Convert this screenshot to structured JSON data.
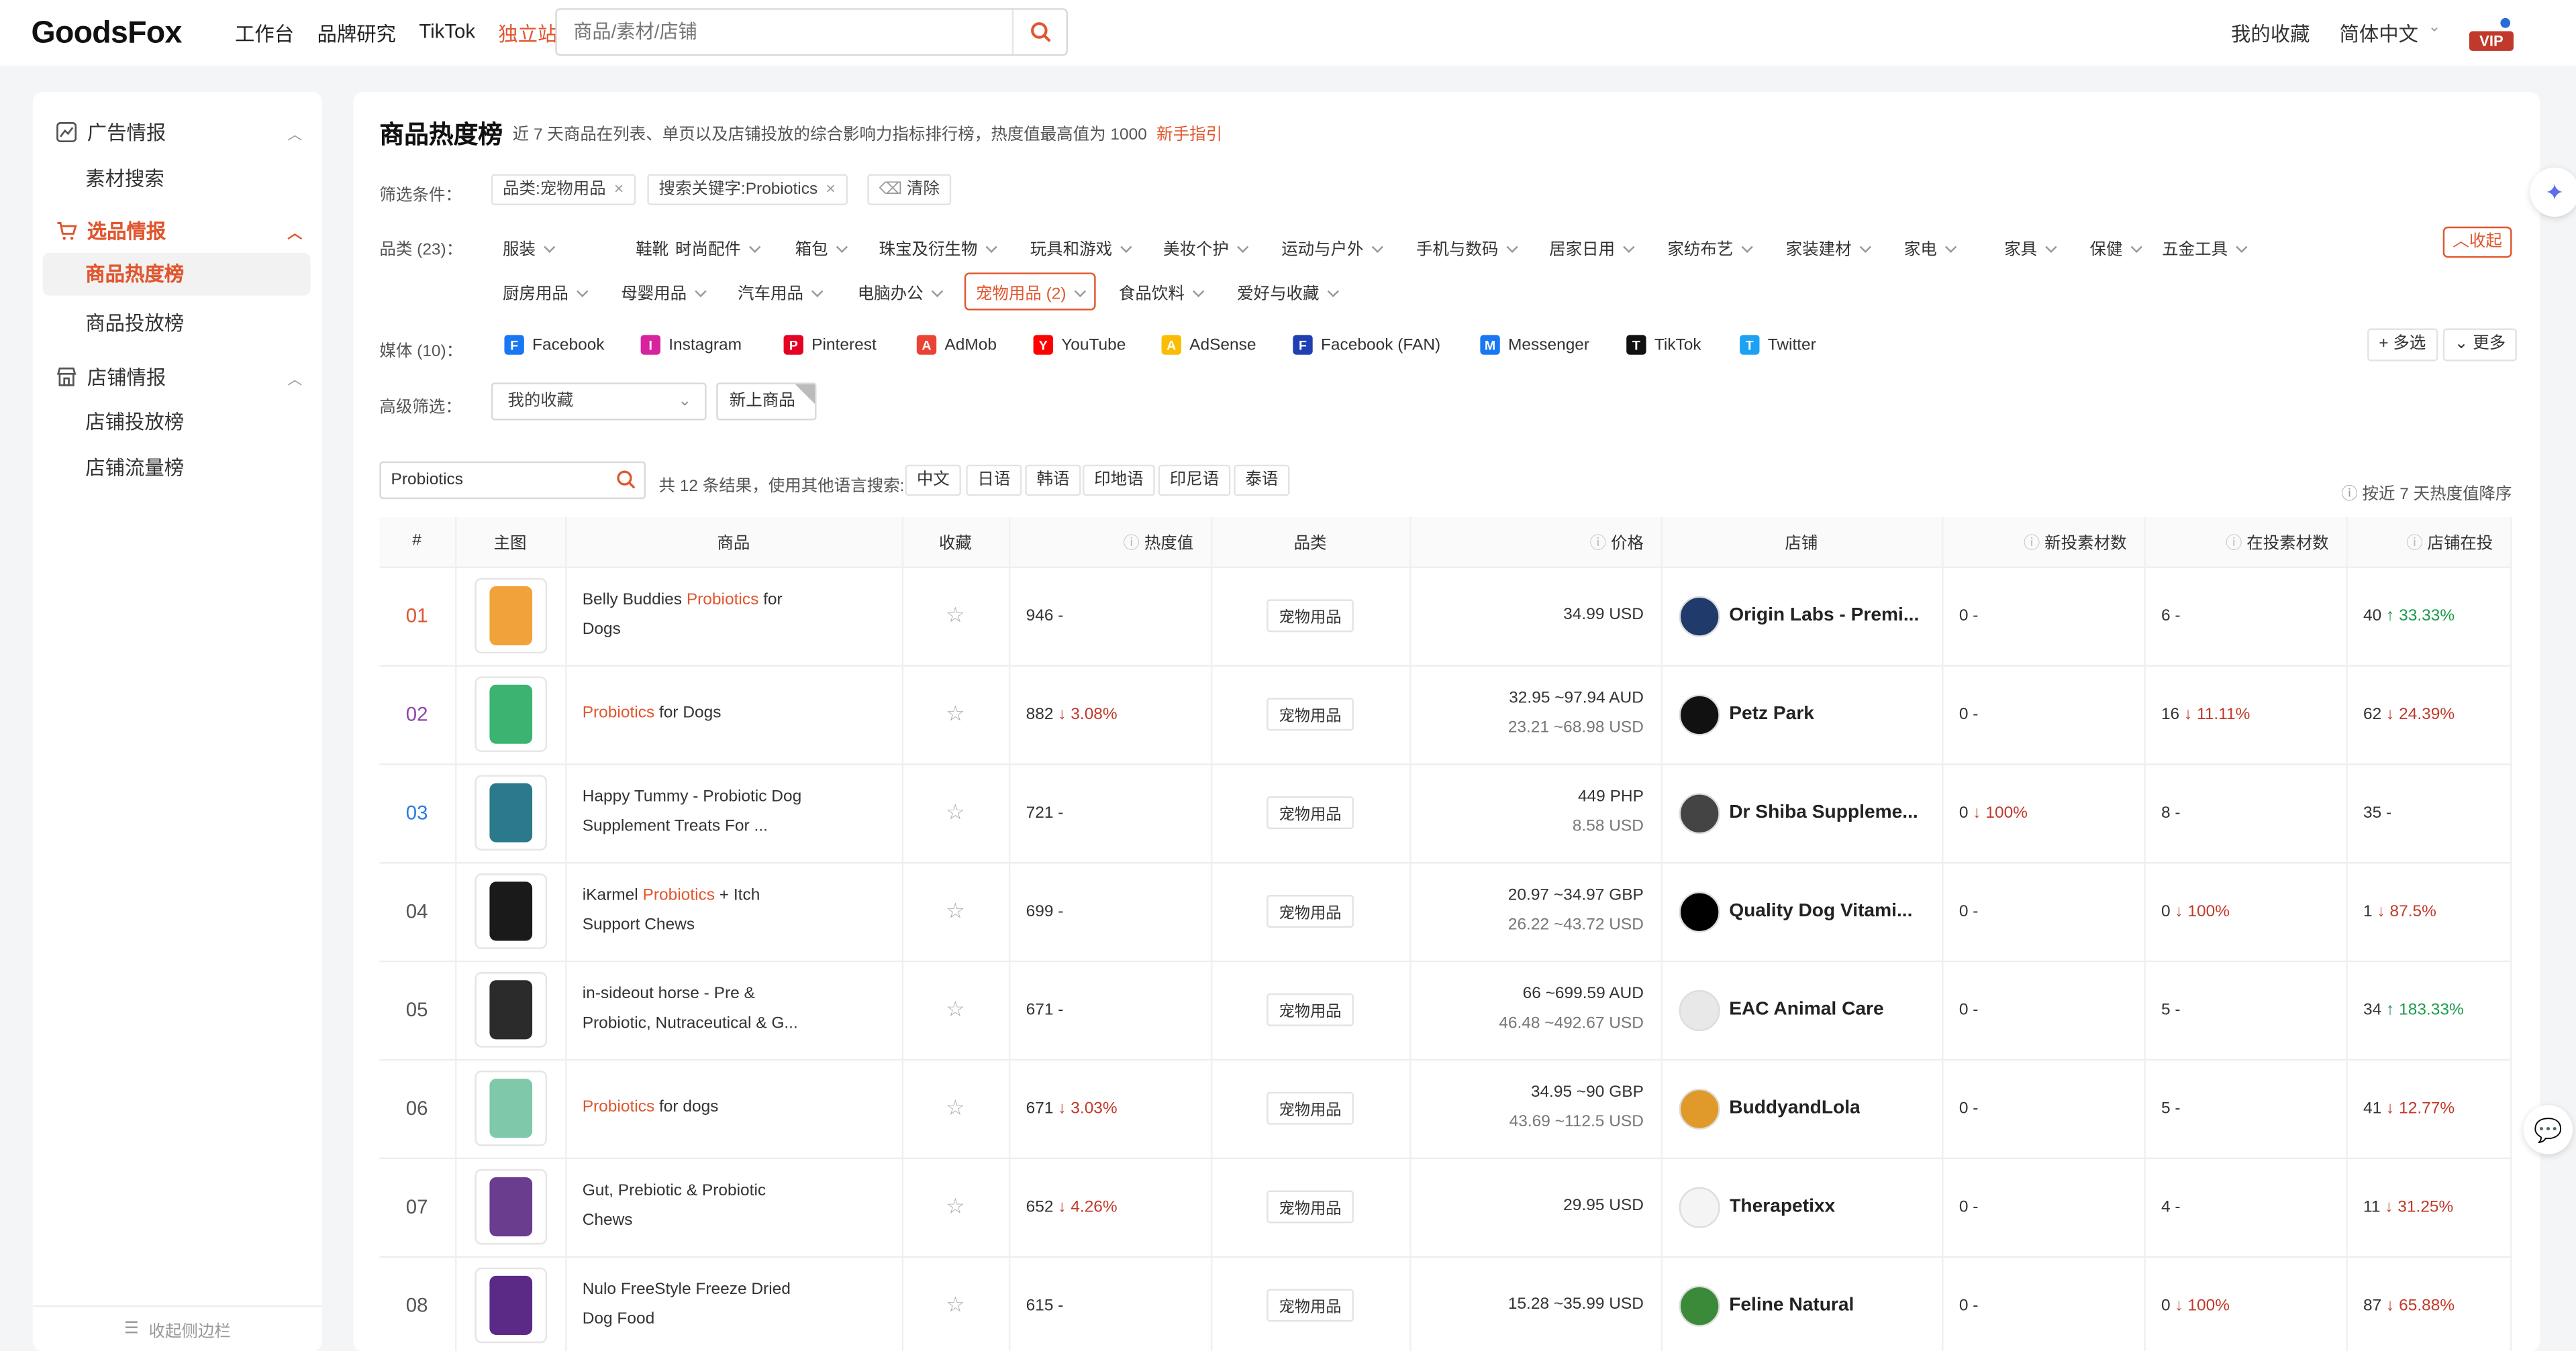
{
  "app": {
    "logo_text": "GoodsFox",
    "logo_mark": "x",
    "vip": "VIP",
    "accent": "#e0562f"
  },
  "nav": [
    "工作台",
    "品牌研究",
    "TikTok",
    "独立站"
  ],
  "search": {
    "placeholder": "商品/素材/店铺"
  },
  "header_right": {
    "favorites": "我的收藏",
    "language": "简体中文"
  },
  "sidebar": {
    "groups": [
      {
        "label": "广告情报",
        "icon": "ad-icon",
        "items": [
          "素材搜索"
        ]
      },
      {
        "label": "选品情报",
        "icon": "cart-icon",
        "items": [
          "商品热度榜",
          "商品投放榜"
        ]
      },
      {
        "label": "店铺情报",
        "icon": "store-icon",
        "items": [
          "店铺投放榜",
          "店铺流量榜"
        ]
      }
    ],
    "collapse": "收起侧边栏"
  },
  "page": {
    "title": "商品热度榜",
    "desc": "近 7 天商品在列表、单页以及店铺投放的综合影响力指标排行榜，热度值最高值为 1000",
    "guide": "新手指引"
  },
  "filters": {
    "label": "筛选条件：",
    "chips": [
      "品类:宠物用品",
      "搜索关键字:Probiotics"
    ],
    "clear": "清除"
  },
  "categories": {
    "label": "品类 (23)：",
    "row1": [
      "服装",
      "鞋靴",
      "时尚配件",
      "箱包",
      "珠宝及衍生物",
      "玩具和游戏",
      "美妆个护",
      "运动与户外",
      "手机与数码",
      "居家日用",
      "家纺布艺",
      "家装建材",
      "家电",
      "家具",
      "保健",
      "五金工具"
    ],
    "row2": [
      "厨房用品",
      "母婴用品",
      "汽车用品",
      "电脑办公",
      "宠物用品 (2)",
      "食品饮料",
      "爱好与收藏"
    ],
    "fold": "收起"
  },
  "media": {
    "label": "媒体 (10)：",
    "items": [
      {
        "name": "Facebook",
        "icon": "facebook-icon",
        "color": "#1877f2"
      },
      {
        "name": "Instagram",
        "icon": "instagram-icon",
        "color": "#d6249f"
      },
      {
        "name": "Pinterest",
        "icon": "pinterest-icon",
        "color": "#e60023"
      },
      {
        "name": "AdMob",
        "icon": "admob-icon",
        "color": "#ea4335"
      },
      {
        "name": "YouTube",
        "icon": "youtube-icon",
        "color": "#ff0000"
      },
      {
        "name": "AdSense",
        "icon": "adsense-icon",
        "color": "#fbbc04"
      },
      {
        "name": "Facebook (FAN)",
        "icon": "facebook-fan-icon",
        "color": "#1f3fb3"
      },
      {
        "name": "Messenger",
        "icon": "messenger-icon",
        "color": "#1877f2"
      },
      {
        "name": "TikTok",
        "icon": "tiktok-icon",
        "color": "#111111"
      },
      {
        "name": "Twitter",
        "icon": "twitter-icon",
        "color": "#1da1f2"
      }
    ],
    "multi": "多选",
    "more": "更多"
  },
  "advanced": {
    "label": "高级筛选：",
    "select": "我的收藏",
    "new": "新上商品"
  },
  "keyword": {
    "value": "Probiotics",
    "info": "共 12 条结果，使用其他语言搜索:",
    "langs": [
      "中文",
      "日语",
      "韩语",
      "印地语",
      "印尼语",
      "泰语"
    ],
    "sort": "按近 7 天热度值降序"
  },
  "table": {
    "headers": [
      "#",
      "主图",
      "商品",
      "收藏",
      "热度值",
      "品类",
      "价格",
      "店铺",
      "新投素材数",
      "在投素材数",
      "店铺在投"
    ],
    "rows": [
      {
        "rank": "01",
        "name_pre": "Belly Buddies ",
        "name_hl": "Probiotics",
        "name_post": " for Dogs",
        "heat": "946",
        "heat_trend": "-",
        "cat": "宠物用品",
        "price1": "34.99 USD",
        "price2": "",
        "shop": "Origin Labs - Premi...",
        "new": "0",
        "new_trend": "-",
        "active": "6",
        "active_trend": "-",
        "store": "40",
        "store_trend": "↑ 33.33%",
        "thumb": "#f2a23a",
        "slogo": "#1f3a6b"
      },
      {
        "rank": "02",
        "name_pre": "",
        "name_hl": "Probiotics",
        "name_post": " for Dogs",
        "heat": "882",
        "heat_trend": "↓ 3.08%",
        "cat": "宠物用品",
        "price1": "32.95 ~97.94 AUD",
        "price2": "23.21 ~68.98 USD",
        "shop": "Petz Park",
        "new": "0",
        "new_trend": "-",
        "active": "16",
        "active_trend": "↓ 11.11%",
        "store": "62",
        "store_trend": "↓ 24.39%",
        "thumb": "#3cb371",
        "slogo": "#111111"
      },
      {
        "rank": "03",
        "name_pre": "Happy Tummy - Probiotic Dog Supplement Treats For ...",
        "name_hl": "",
        "name_post": "",
        "heat": "721",
        "heat_trend": "-",
        "cat": "宠物用品",
        "price1": "449 PHP",
        "price2": "8.58 USD",
        "shop": "Dr Shiba Suppleme...",
        "new": "0",
        "new_trend": "↓ 100%",
        "active": "8",
        "active_trend": "-",
        "store": "35",
        "store_trend": "-",
        "thumb": "#2a7a8c",
        "slogo": "#444444"
      },
      {
        "rank": "04",
        "name_pre": "iKarmel ",
        "name_hl": "Probiotics",
        "name_post": " + Itch Support Chews",
        "heat": "699",
        "heat_trend": "-",
        "cat": "宠物用品",
        "price1": "20.97 ~34.97 GBP",
        "price2": "26.22 ~43.72 USD",
        "shop": "Quality Dog Vitami...",
        "new": "0",
        "new_trend": "-",
        "active": "0",
        "active_trend": "↓ 100%",
        "store": "1",
        "store_trend": "↓ 87.5%",
        "thumb": "#1a1a1a",
        "slogo": "#000000"
      },
      {
        "rank": "05",
        "name_pre": "in-sideout horse - Pre & Probiotic, Nutraceutical & G...",
        "name_hl": "",
        "name_post": "",
        "heat": "671",
        "heat_trend": "-",
        "cat": "宠物用品",
        "price1": "66 ~699.59 AUD",
        "price2": "46.48 ~492.67 USD",
        "shop": "EAC Animal Care",
        "new": "0",
        "new_trend": "-",
        "active": "5",
        "active_trend": "-",
        "store": "34",
        "store_trend": "↑ 183.33%",
        "thumb": "#2b2b2b",
        "slogo": "#e8e8e8"
      },
      {
        "rank": "06",
        "name_pre": "",
        "name_hl": "Probiotics",
        "name_post": " for dogs",
        "heat": "671",
        "heat_trend": "↓ 3.03%",
        "cat": "宠物用品",
        "price1": "34.95 ~90 GBP",
        "price2": "43.69 ~112.5 USD",
        "shop": "BuddyandLola",
        "new": "0",
        "new_trend": "-",
        "active": "5",
        "active_trend": "-",
        "store": "41",
        "store_trend": "↓ 12.77%",
        "thumb": "#7fc8a9",
        "slogo": "#e09a2a"
      },
      {
        "rank": "07",
        "name_pre": "Gut, Prebiotic & Probiotic Chews",
        "name_hl": "",
        "name_post": "",
        "heat": "652",
        "heat_trend": "↓ 4.26%",
        "cat": "宠物用品",
        "price1": "29.95 USD",
        "price2": "",
        "shop": "Therapetixx",
        "new": "0",
        "new_trend": "-",
        "active": "4",
        "active_trend": "-",
        "store": "11",
        "store_trend": "↓ 31.25%",
        "thumb": "#6a3d8f",
        "slogo": "#f4f4f4"
      },
      {
        "rank": "08",
        "name_pre": "Nulo FreeStyle Freeze Dried Dog Food",
        "name_hl": "",
        "name_post": "",
        "heat": "615",
        "heat_trend": "-",
        "cat": "宠物用品",
        "price1": "15.28 ~35.99 USD",
        "price2": "",
        "shop": "Feline Natural",
        "new": "0",
        "new_trend": "-",
        "active": "0",
        "active_trend": "↓ 100%",
        "store": "87",
        "store_trend": "↓ 65.88%",
        "thumb": "#5b2a86",
        "slogo": "#3a8a3a"
      }
    ]
  }
}
